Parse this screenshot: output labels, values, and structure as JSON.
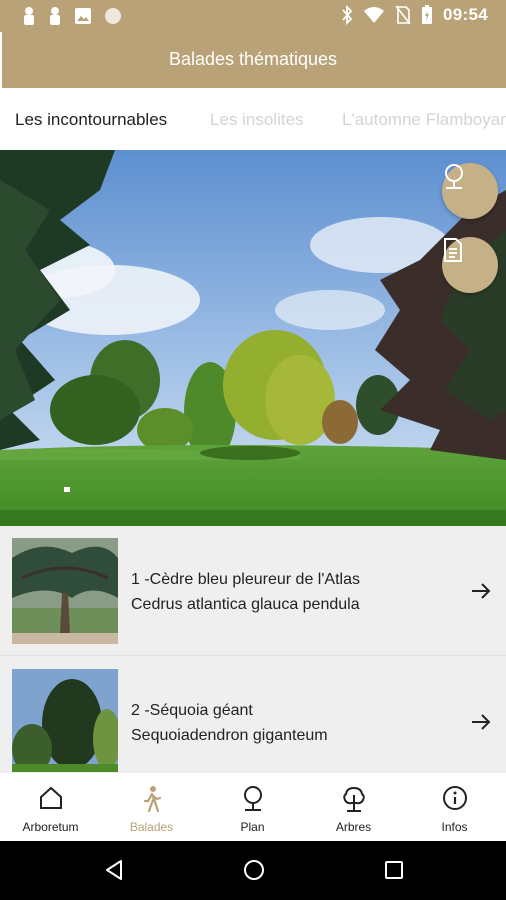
{
  "status_bar": {
    "time": "09:54",
    "left_icons": [
      "notification-icon",
      "notification-icon",
      "image-icon",
      "circle-icon"
    ],
    "right_icons": [
      "bluetooth-icon",
      "wifi-icon",
      "no-sim-icon",
      "battery-icon"
    ]
  },
  "app_bar": {
    "title": "Balades thématiques"
  },
  "tabs": [
    {
      "label": "Les incontournables",
      "active": true
    },
    {
      "label": "Les insolites",
      "active": false
    },
    {
      "label": "L'automne Flamboyant",
      "active": false
    }
  ],
  "hero": {
    "actions": [
      {
        "icon": "map-pin-icon"
      },
      {
        "icon": "document-icon"
      }
    ]
  },
  "list": {
    "items": [
      {
        "title": "1 -Cèdre bleu pleureur de l'Atlas",
        "subtitle": "Cedrus atlantica glauca pendula",
        "icon": "arrow-right-icon"
      },
      {
        "title": "2 -Séquoia géant",
        "subtitle": "Sequoiadendron giganteum",
        "icon": "arrow-right-icon"
      }
    ]
  },
  "bottom_nav": {
    "items": [
      {
        "label": "Arboretum",
        "icon": "home-icon",
        "active": false
      },
      {
        "label": "Balades",
        "icon": "walk-icon",
        "active": true
      },
      {
        "label": "Plan",
        "icon": "map-pin-icon",
        "active": false
      },
      {
        "label": "Arbres",
        "icon": "tree-icon",
        "active": false
      },
      {
        "label": "Infos",
        "icon": "info-icon",
        "active": false
      }
    ]
  },
  "colors": {
    "accent": "#b9a277",
    "fab": "#c6b088",
    "list_bg": "#efefef"
  }
}
